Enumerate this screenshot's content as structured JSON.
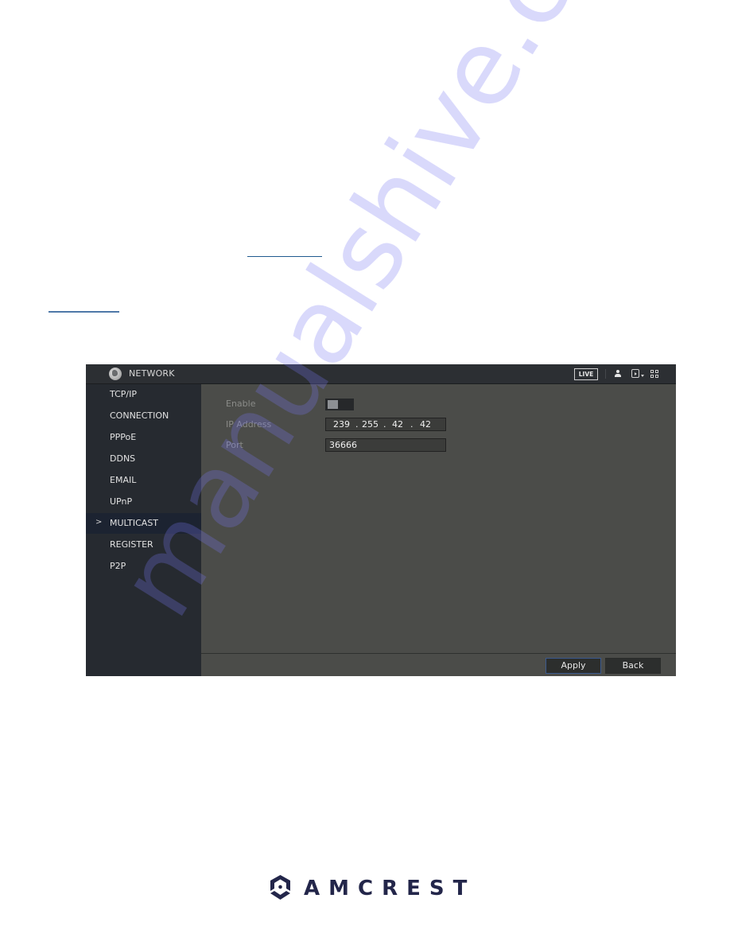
{
  "document": {
    "links": [
      {
        "id": "link-1",
        "text": ""
      },
      {
        "id": "link-2",
        "text": ""
      }
    ],
    "watermark": "manualshive.com"
  },
  "dvr": {
    "header": {
      "icon": "globe-icon",
      "title": "NETWORK",
      "live_label": "LIVE",
      "icons": [
        "user-icon",
        "logout-icon",
        "caret-down-icon",
        "grid-icon"
      ]
    },
    "sidebar": {
      "items": [
        {
          "label": "TCP/IP",
          "active": false
        },
        {
          "label": "CONNECTION",
          "active": false
        },
        {
          "label": "PPPoE",
          "active": false
        },
        {
          "label": "DDNS",
          "active": false
        },
        {
          "label": "EMAIL",
          "active": false
        },
        {
          "label": "UPnP",
          "active": false
        },
        {
          "label": "MULTICAST",
          "active": true
        },
        {
          "label": "REGISTER",
          "active": false
        },
        {
          "label": "P2P",
          "active": false
        }
      ],
      "active_marker": ">"
    },
    "form": {
      "enable_label": "Enable",
      "enable_value": false,
      "ip_label": "IP Address",
      "ip_octets": [
        "239",
        "255",
        "42",
        "42"
      ],
      "ip_dot": ".",
      "port_label": "Port",
      "port_value": "36666"
    },
    "buttons": {
      "apply": "Apply",
      "back": "Back"
    }
  },
  "branding": {
    "logo_text": "AMCREST",
    "colors": {
      "text": "#23264a",
      "accent": "#2f7bd6"
    }
  }
}
